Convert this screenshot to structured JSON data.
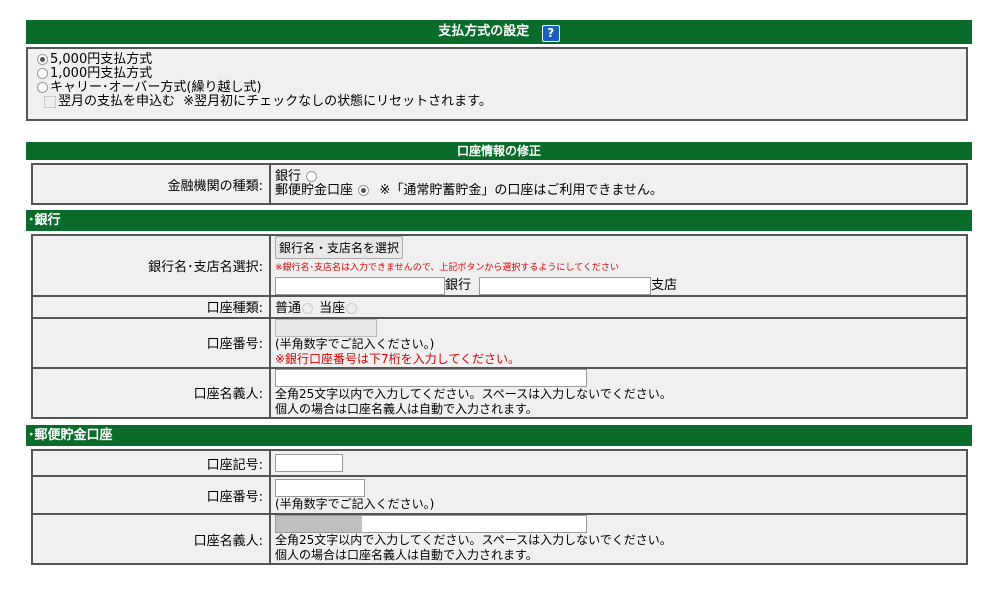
{
  "payment": {
    "title": "支払方式の設定",
    "help_icon": "?",
    "options": [
      "5,000円支払方式",
      "1,000円支払方式",
      "キャリー･オーバー方式(繰り越し式)"
    ],
    "checkbox_label": "翌月の支払を申込む",
    "note": "※翌月初にチェックなしの状態にリセットされます。"
  },
  "account": {
    "title": "口座情報の修正",
    "type_label": "金融機関の種類:",
    "bank_option": "銀行",
    "post_option": "郵便貯金口座",
    "post_note": "※「通常貯蓄貯金」の口座はご利用できません。"
  },
  "bank": {
    "section_title": "･銀行",
    "select_label": "銀行名･支店名選択:",
    "select_button": "銀行名・支店名を選択",
    "select_note": "※銀行名･支店名は入力できませんので、上記ボタンから選択するようにしてください",
    "bank_suffix": "銀行",
    "branch_suffix": "支店",
    "acct_type_label": "口座種類:",
    "acct_type_normal": "普通",
    "acct_type_current": "当座",
    "acct_number_label": "口座番号:",
    "acct_number_hint": "(半角数字でご記入ください。)",
    "acct_number_warning": "※銀行口座番号は下7桁を入力してください。",
    "holder_label": "口座名義人:",
    "holder_hint1": "全角25文字以内で入力してください。スペースは入力しないでください。",
    "holder_hint2": "個人の場合は口座名義人は自動で入力されます。"
  },
  "post": {
    "section_title": "･郵便貯金口座",
    "code_label": "口座記号:",
    "number_label": "口座番号:",
    "number_hint": "(半角数字でご記入ください。)",
    "holder_label": "口座名義人:",
    "holder_hint1": "全角25文字以内で入力してください。スペースは入力しないでください。",
    "holder_hint2": "個人の場合は口座名義人は自動で入力されます。"
  }
}
